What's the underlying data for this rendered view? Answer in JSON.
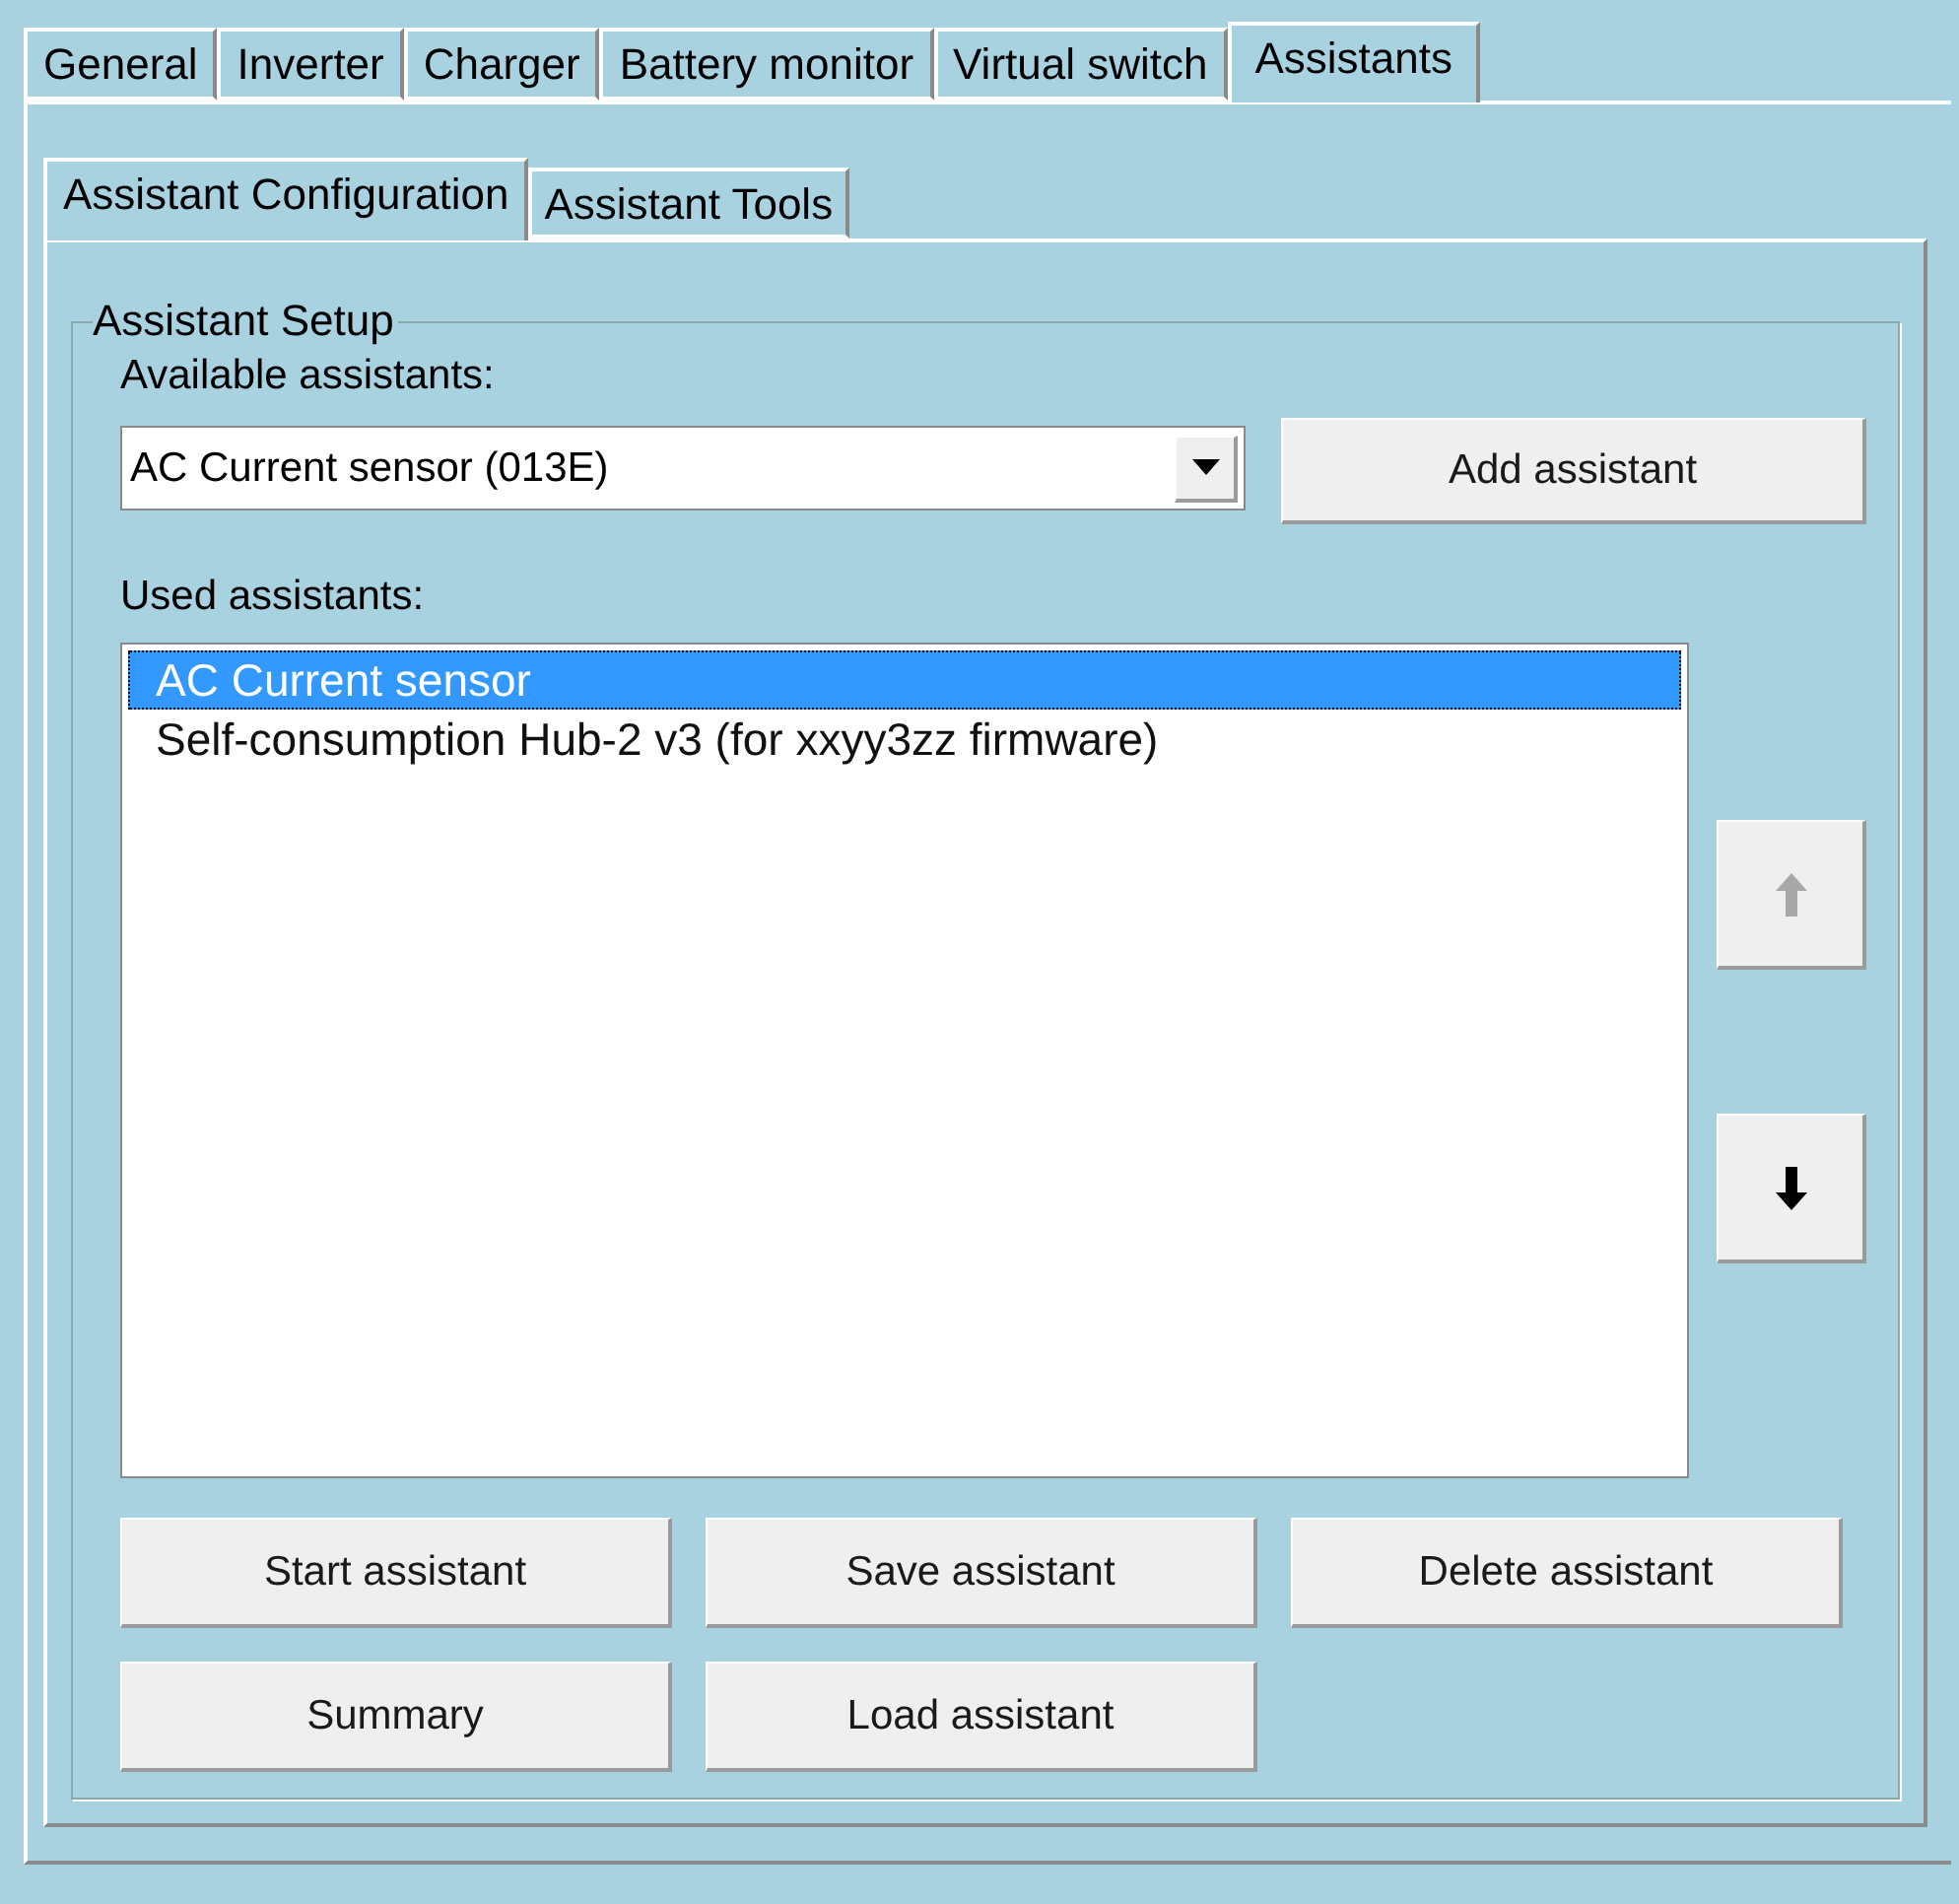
{
  "tabs": [
    {
      "label": "General",
      "selected": false
    },
    {
      "label": "Inverter",
      "selected": false
    },
    {
      "label": "Charger",
      "selected": false
    },
    {
      "label": "Battery monitor",
      "selected": false
    },
    {
      "label": "Virtual switch",
      "selected": false
    },
    {
      "label": "Assistants",
      "selected": true
    }
  ],
  "subtabs": [
    {
      "label": "Assistant Configuration",
      "selected": true
    },
    {
      "label": "Assistant Tools",
      "selected": false
    }
  ],
  "group": {
    "title": "Assistant Setup",
    "available_label": "Available assistants:",
    "dropdown": {
      "value": "AC Current sensor (013E)"
    },
    "add_button": "Add assistant",
    "used_label": "Used assistants:",
    "used_list": [
      {
        "label": "AC Current sensor",
        "selected": true
      },
      {
        "label": "Self-consumption Hub-2 v3 (for xxyy3zz firmware)",
        "selected": false
      }
    ],
    "move_up": {
      "disabled": true
    },
    "move_down": {
      "disabled": false
    },
    "buttons": [
      [
        "Start assistant",
        "Save assistant",
        "Delete assistant"
      ],
      [
        "Summary",
        "Load assistant"
      ]
    ]
  }
}
